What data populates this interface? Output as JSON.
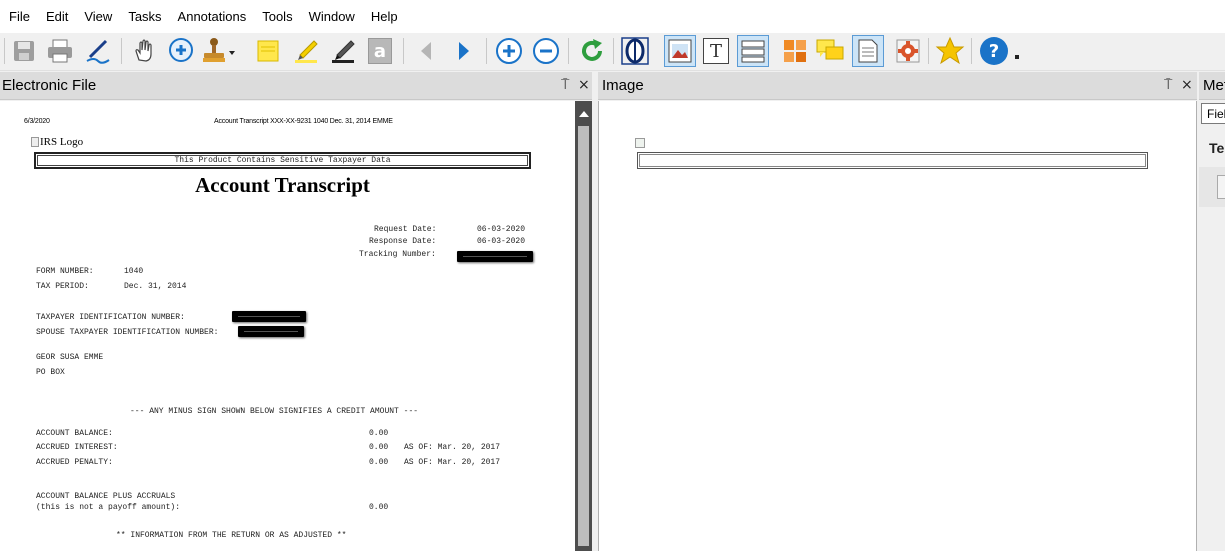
{
  "menu": [
    "File",
    "Edit",
    "View",
    "Tasks",
    "Annotations",
    "Tools",
    "Window",
    "Help"
  ],
  "toolbar": {
    "icons": [
      "save-icon",
      "print-icon",
      "signature-pen-icon",
      "hand-pan-icon",
      "zoom-in-magnifier-icon",
      "stamp-icon",
      "sticky-note-icon",
      "highlighter-icon",
      "marker-icon",
      "text-box-icon",
      "previous-arrow-icon",
      "next-arrow-icon",
      "zoom-in-icon",
      "zoom-out-icon",
      "refresh-icon",
      "fit-page-icon",
      "image-view-icon",
      "text-view-icon",
      "form-fields-icon",
      "grid-view-icon",
      "comments-icon",
      "document-icon",
      "settings-gear-icon",
      "favorite-star-icon",
      "help-icon"
    ],
    "text_box_glyph": "a",
    "text_view_glyph": "T",
    "help_glyph": "?"
  },
  "panels": {
    "electronic_file": {
      "title": "Electronic File",
      "pin": "⍑",
      "close": "×"
    },
    "image": {
      "title": "Image",
      "pin": "⍑",
      "close": "×"
    },
    "metadata": {
      "title": "Met",
      "field_label": "Fiel",
      "tab_label": "Te"
    }
  },
  "document": {
    "header_date": "6/3/2020",
    "header_title": "Account Transcript XXX-XX-9231 1040 Dec. 31, 2014 EMME",
    "logo_alt": "IRS Logo",
    "sensitive_banner": "This Product Contains Sensitive Taxpayer Data",
    "title": "Account Transcript",
    "request_date_label": "Request Date:",
    "request_date_value": "06-03-2020",
    "response_date_label": "Response Date:",
    "response_date_value": "06-03-2020",
    "tracking_label": "Tracking Number:",
    "form_number_label": "FORM NUMBER:",
    "form_number_value": "1040",
    "tax_period_label": "TAX PERIOD:",
    "tax_period_value": "Dec. 31, 2014",
    "taxpayer_id_label": "TAXPAYER IDENTIFICATION NUMBER:",
    "spouse_id_label": "SPOUSE TAXPAYER IDENTIFICATION NUMBER:",
    "name_line": "GEOR SUSA EMME",
    "address_line": "PO BOX",
    "minus_sign_notice": "--- ANY MINUS SIGN SHOWN BELOW SIGNIFIES A CREDIT AMOUNT ---",
    "account_balance_label": "ACCOUNT BALANCE:",
    "account_balance_value": "0.00",
    "accrued_interest_label": "ACCRUED INTEREST:",
    "accrued_interest_value": "0.00",
    "accrued_interest_asof": "AS OF: Mar. 20, 2017",
    "accrued_penalty_label": "ACCRUED PENALTY:",
    "accrued_penalty_value": "0.00",
    "accrued_penalty_asof": "AS OF: Mar. 20, 2017",
    "balance_plus_accruals_label": "ACCOUNT BALANCE PLUS ACCRUALS",
    "payoff_note": "(this is not a payoff amount):",
    "balance_plus_accruals_value": "0.00",
    "return_info_heading": "** INFORMATION FROM THE RETURN OR AS ADJUSTED **"
  },
  "colors": {
    "accent_blue": "#1a73c8",
    "pressed_bg": "#cce4f7",
    "panel_header": "#dcdcdc",
    "scrollbar": "#4d4d4d"
  }
}
